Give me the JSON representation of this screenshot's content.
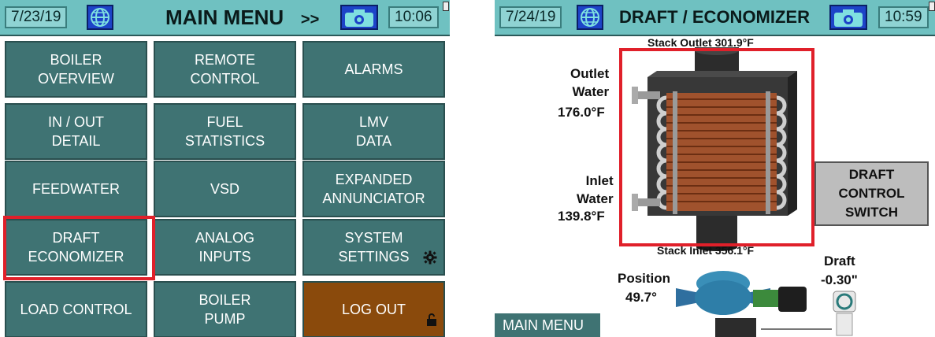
{
  "left": {
    "date": "7/23/19",
    "title": "MAIN MENU",
    "title_arrow": ">>",
    "time": "10:06",
    "buttons": [
      {
        "label": "BOILER\nOVERVIEW"
      },
      {
        "label": "REMOTE\nCONTROL"
      },
      {
        "label": "ALARMS"
      },
      {
        "label": "IN / OUT\nDETAIL"
      },
      {
        "label": "FUEL\nSTATISTICS"
      },
      {
        "label": "LMV\nDATA"
      },
      {
        "label": "FEEDWATER"
      },
      {
        "label": "VSD"
      },
      {
        "label": "EXPANDED\nANNUNCIATOR"
      },
      {
        "label": "DRAFT\nECONOMIZER"
      },
      {
        "label": "ANALOG\nINPUTS"
      },
      {
        "label": "SYSTEM\nSETTINGS"
      },
      {
        "label": "LOAD CONTROL"
      },
      {
        "label": "BOILER\nPUMP"
      },
      {
        "label": "LOG OUT"
      }
    ],
    "colors": {
      "button": "#3f7373",
      "logout": "#8a4a0c",
      "highlight": "#e0202a",
      "header": "#6fc1c1"
    }
  },
  "right": {
    "date": "7/24/19",
    "title": "DRAFT / ECONOMIZER",
    "time": "10:59",
    "stack_outlet": "Stack Outlet 301.9°F",
    "stack_inlet": "Stack Inlet 356.1°F",
    "outlet_water_label": "Outlet\nWater",
    "outlet_water_value": "176.0°F",
    "inlet_water_label": "Inlet\nWater",
    "inlet_water_value": "139.8°F",
    "draft_switch": "DRAFT\nCONTROL\nSWITCH",
    "position_label": "Position",
    "position_value": "49.7°",
    "draft_label": "Draft",
    "draft_value": "-0.30\"",
    "main_menu": "MAIN MENU"
  }
}
